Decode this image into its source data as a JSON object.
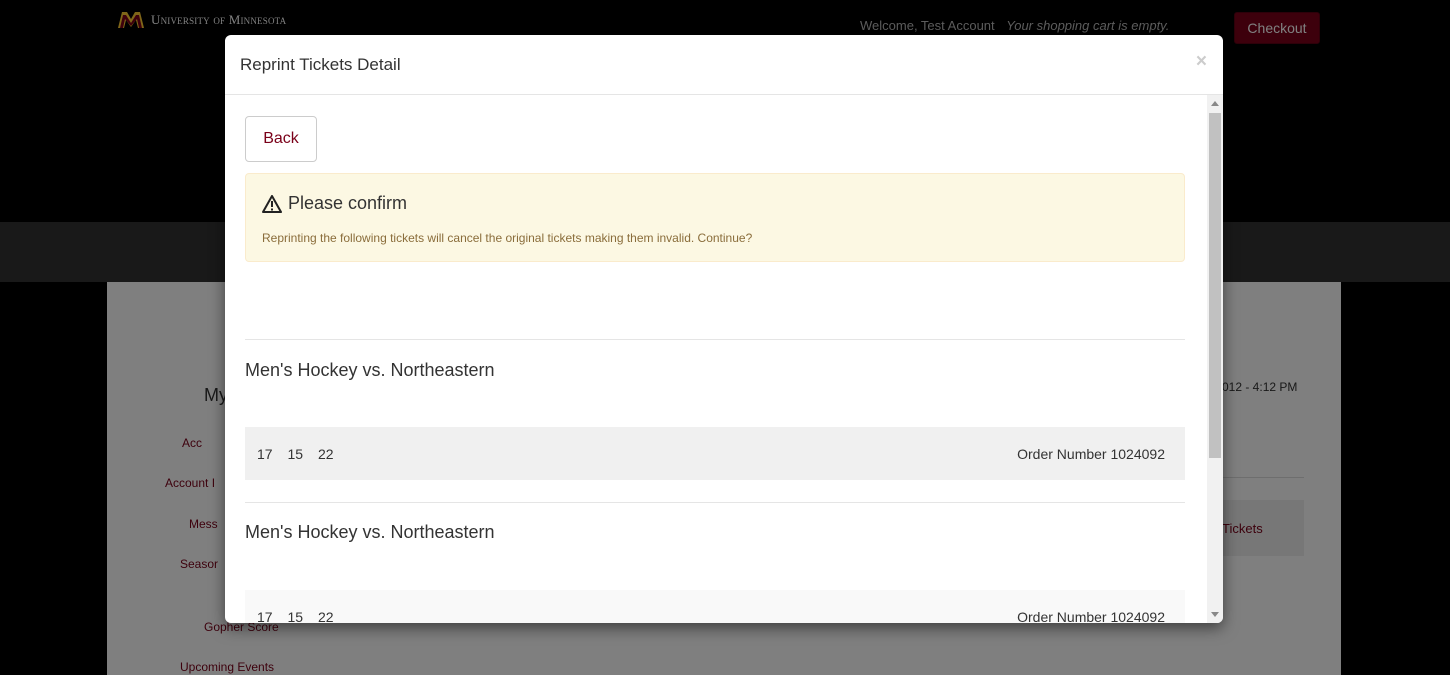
{
  "header": {
    "university": "University of Minnesota",
    "welcome": "Welcome, Test Account",
    "cart_status": "Your shopping cart is empty.",
    "checkout_label": "Checkout"
  },
  "background": {
    "side_title": "My",
    "side_links": [
      "Acc",
      "Account I",
      "Mess",
      "Seasor",
      "Gopher Score",
      "Upcoming Events"
    ],
    "datetime": "012 - 4:12 PM",
    "tickets_tab": "Tickets"
  },
  "modal": {
    "title": "Reprint Tickets Detail",
    "close_glyph": "×",
    "back_label": "Back",
    "alert": {
      "title": "Please confirm",
      "message": "Reprinting the following tickets will cancel the original tickets making them invalid. Continue?"
    },
    "tickets": [
      {
        "event": "Men's Hockey vs. Northeastern",
        "seats": [
          "17",
          "15",
          "22"
        ],
        "order_label": "Order Number",
        "order_number": "1024092"
      },
      {
        "event": "Men's Hockey vs. Northeastern",
        "seats": [
          "17",
          "15",
          "22"
        ],
        "order_label": "Order Number",
        "order_number": "1024092"
      }
    ]
  },
  "colors": {
    "brand_maroon": "#7a0019",
    "brand_gold": "#ffcc33",
    "alert_bg": "#fcf8e3"
  },
  "icons": {
    "logo": "university-m-logo",
    "warning": "warning-triangle-icon",
    "close": "close-icon"
  }
}
